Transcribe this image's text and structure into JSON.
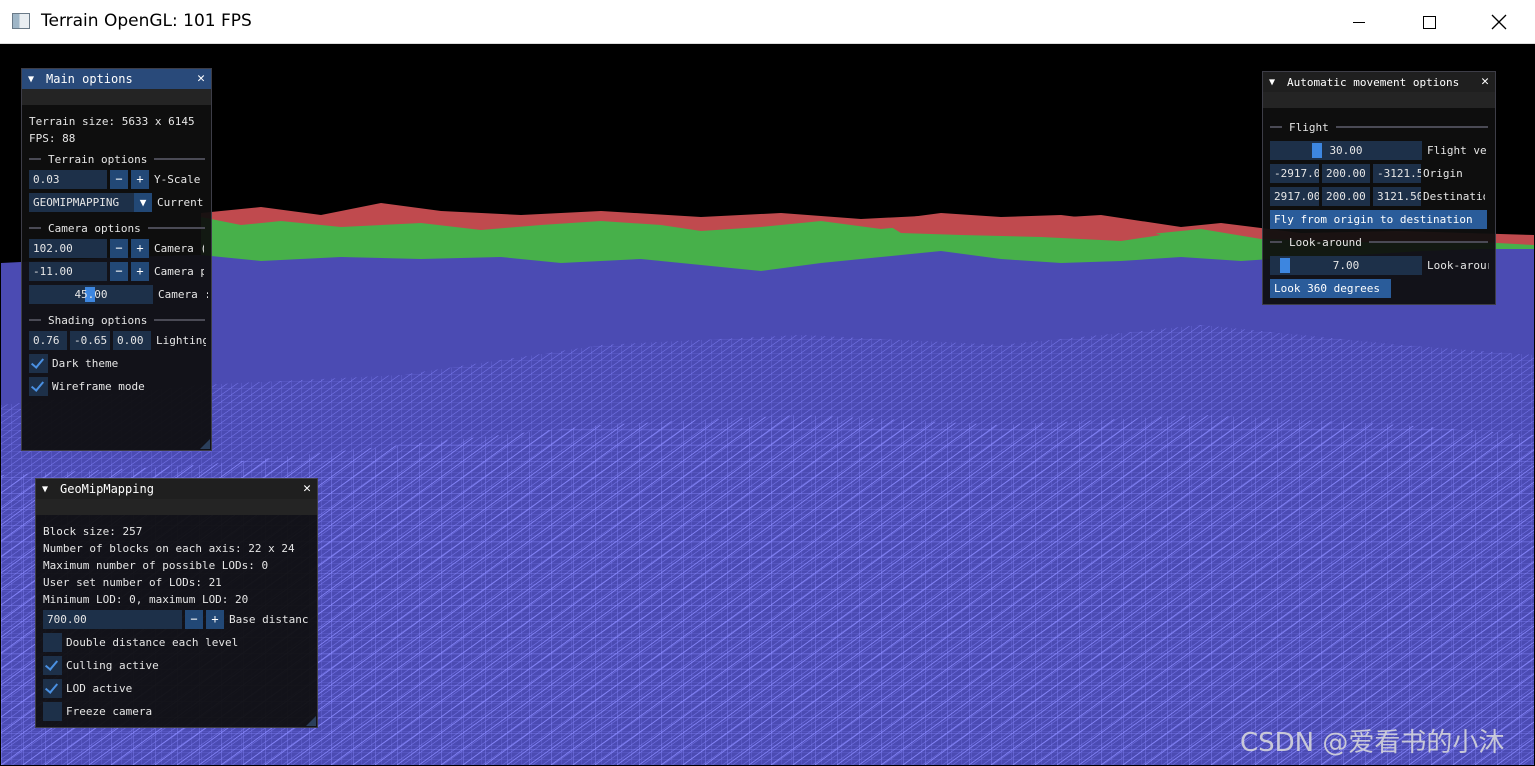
{
  "window": {
    "title": "Terrain OpenGL: 101 FPS"
  },
  "main_options": {
    "title": "Main options",
    "terrain_size": "Terrain size: 5633 x 6145",
    "fps": "FPS: 88",
    "terrain_section": "Terrain options",
    "y_scale_value": "0.03",
    "y_scale_label": "Y-Scale",
    "minus": "−",
    "plus": "+",
    "combo_value": "GEOMIPMAPPING",
    "combo_arrow": "▼",
    "combo_label": "Current",
    "camera_section": "Camera options",
    "cam1_value": "102.00",
    "cam1_label": "Camera (",
    "cam2_value": "-11.00",
    "cam2_label": "Camera p",
    "cam3_value": "45.00",
    "cam3_label": "Camera :",
    "shading_section": "Shading options",
    "light_x": "0.76",
    "light_y": "-0.65",
    "light_z": "0.00",
    "light_label": "Lighting",
    "dark_theme": "Dark theme",
    "wireframe": "Wireframe mode"
  },
  "geomip": {
    "title": "GeoMipMapping",
    "block_size": "Block size: 257",
    "blocks_axis": "Number of blocks on each axis: 22 x 24",
    "max_lods": "Maximum number of possible LODs: 0",
    "user_lods": "User set number of LODs: 21",
    "min_max_lod": "Minimum LOD: 0, maximum LOD: 20",
    "base_value": "700.00",
    "base_label": "Base distanc",
    "double_distance": "Double distance each level",
    "culling": "Culling active",
    "lod_active": "LOD active",
    "freeze_camera": "Freeze camera"
  },
  "auto_move": {
    "title": "Automatic movement options",
    "flight_section": "Flight",
    "flight_velocity_value": "30.00",
    "flight_velocity_label": "Flight ve",
    "origin_x": "-2917.0",
    "origin_y": "200.00",
    "origin_z": "-3121.5",
    "origin_label": "Origin",
    "dest_x": "2917.00",
    "dest_y": "200.00",
    "dest_z": "3121.50",
    "dest_label": "Destinatio",
    "fly_button": "Fly from origin to destination",
    "look_section": "Look-around",
    "look_value": "7.00",
    "look_label": "Look-arour",
    "look_button": "Look 360 degrees"
  },
  "watermark": "CSDN @爱看书的小沐",
  "close_glyph": "✕",
  "collapse_glyph": "▼",
  "checked": {
    "dark_theme": true,
    "wireframe": true,
    "double_distance": false,
    "culling": true,
    "lod_active": true,
    "freeze_camera": false
  },
  "colors": {
    "terrain_blue": "#4b4bb3",
    "terrain_green": "#47b04a",
    "terrain_red": "#c04a4e",
    "wire": "#8a8aff",
    "title_active": "#294a7a"
  }
}
